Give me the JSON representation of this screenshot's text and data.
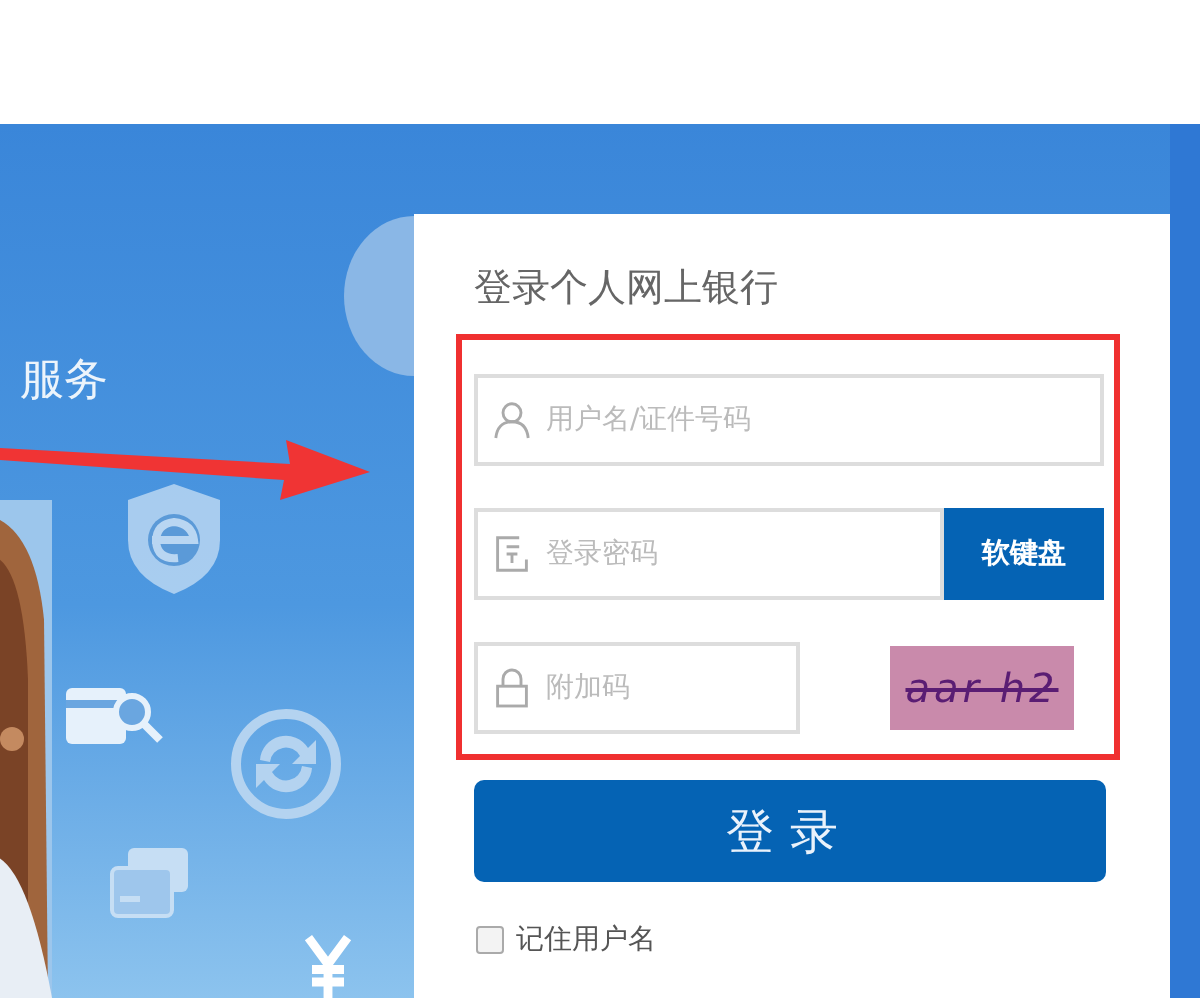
{
  "banner": {
    "slogan": "服务"
  },
  "login": {
    "title": "登录个人网上银行",
    "username": {
      "placeholder": "用户名/证件号码"
    },
    "password": {
      "placeholder": "登录密码",
      "keyboard_button": "软键盘"
    },
    "captcha": {
      "placeholder": "附加码",
      "code": "aar h2"
    },
    "submit": "登录",
    "remember": {
      "label": "记住用户名",
      "checked": false
    }
  }
}
